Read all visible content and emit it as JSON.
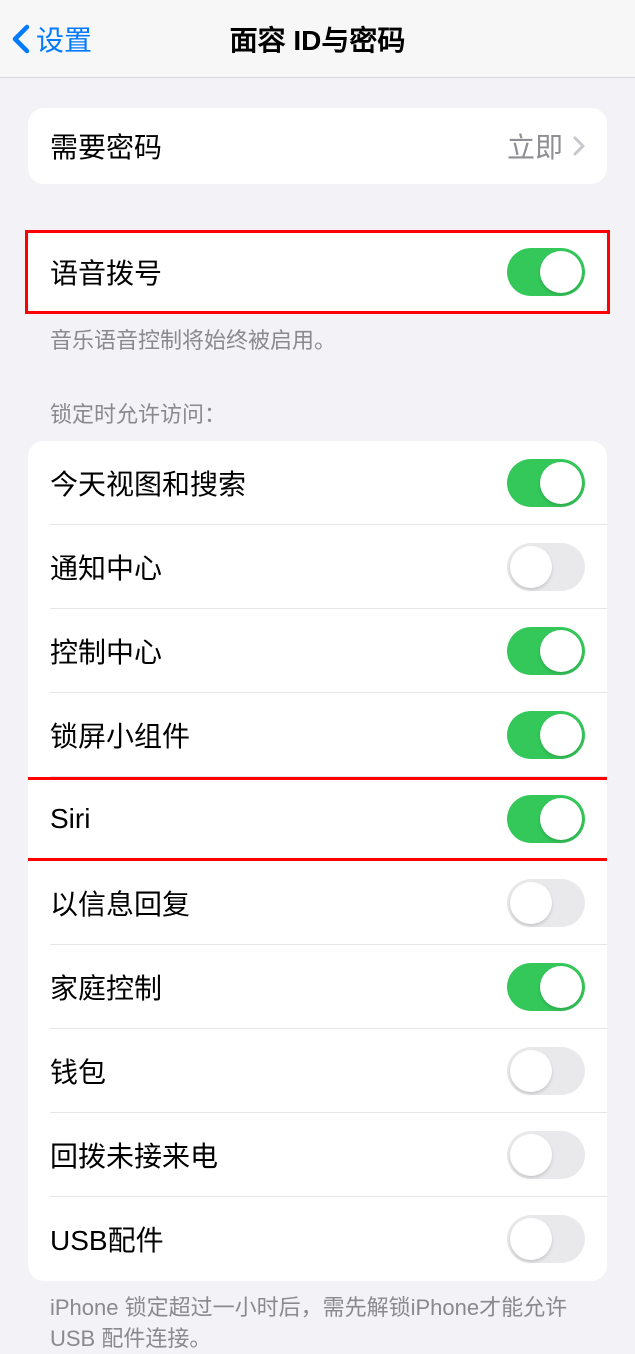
{
  "nav": {
    "back_label": "设置",
    "title": "面容 ID与密码"
  },
  "passcode_section": {
    "require_passcode_label": "需要密码",
    "require_passcode_value": "立即"
  },
  "voice_dial": {
    "label": "语音拨号",
    "enabled": true,
    "footer": "音乐语音控制将始终被启用。"
  },
  "lock_access": {
    "header": "锁定时允许访问：",
    "items": [
      {
        "label": "今天视图和搜索",
        "enabled": true
      },
      {
        "label": "通知中心",
        "enabled": false
      },
      {
        "label": "控制中心",
        "enabled": true
      },
      {
        "label": "锁屏小组件",
        "enabled": true
      },
      {
        "label": "Siri",
        "enabled": true
      },
      {
        "label": "以信息回复",
        "enabled": false
      },
      {
        "label": "家庭控制",
        "enabled": true
      },
      {
        "label": "钱包",
        "enabled": false
      },
      {
        "label": "回拨未接来电",
        "enabled": false
      },
      {
        "label": "USB配件",
        "enabled": false
      }
    ],
    "footer": "iPhone 锁定超过一小时后，需先解锁iPhone才能允许USB 配件连接。"
  }
}
